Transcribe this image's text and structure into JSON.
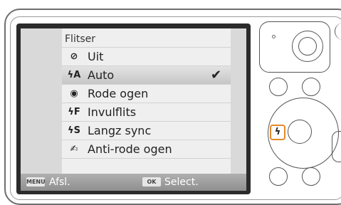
{
  "menu": {
    "title": "Flitser",
    "items": [
      {
        "label": "Uit",
        "icon_glyph": "⊘",
        "icon": "flash-off-icon",
        "selected": false
      },
      {
        "label": "Auto",
        "icon_glyph": "ϟA",
        "icon": "flash-auto-icon",
        "selected": true
      },
      {
        "label": "Rode ogen",
        "icon_glyph": "◉",
        "icon": "red-eye-icon",
        "selected": false
      },
      {
        "label": "Invulflits",
        "icon_glyph": "ϟF",
        "icon": "fill-flash-icon",
        "selected": false
      },
      {
        "label": "Langz sync",
        "icon_glyph": "ϟS",
        "icon": "slow-sync-icon",
        "selected": false
      },
      {
        "label": "Anti-rode ogen",
        "icon_glyph": "✍",
        "icon": "red-eye-fix-icon",
        "selected": false
      }
    ],
    "checkmark": "✔"
  },
  "bottombar": {
    "menu_key": "MENU",
    "back_label": "Afsl.",
    "ok_key": "OK",
    "select_label": "Select."
  },
  "camera": {
    "flash_key_glyph": "ϟ",
    "accent_color": "#e5892a"
  }
}
